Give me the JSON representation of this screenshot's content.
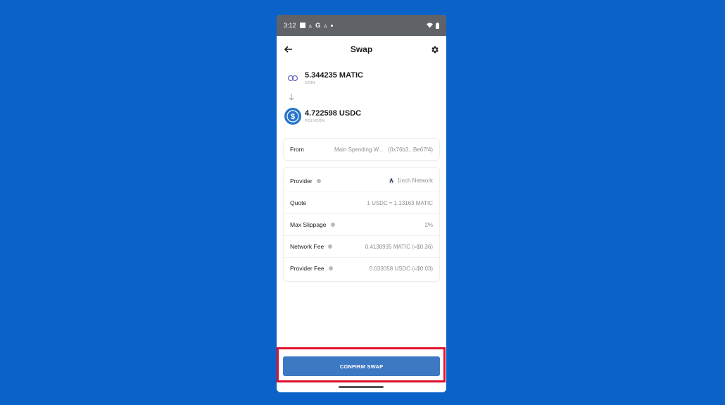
{
  "status_bar": {
    "time": "3:12"
  },
  "header": {
    "title": "Swap"
  },
  "from_asset": {
    "amount": "5.344235 MATIC",
    "network": "COIN"
  },
  "to_asset": {
    "amount": "4.722598 USDC",
    "network": "POLYGON"
  },
  "from_row": {
    "label": "From",
    "wallet": "Main Spending W...",
    "address": "(0x76b3...Be67f4)"
  },
  "details": {
    "provider": {
      "label": "Provider",
      "value": "1inch Network"
    },
    "quote": {
      "label": "Quote",
      "value": "1 USDC ≈ 1.13163 MATIC"
    },
    "slippage": {
      "label": "Max Slippage",
      "value": "2%"
    },
    "network_fee": {
      "label": "Network Fee",
      "value": "0.4130935 MATIC (≈$0.36)"
    },
    "provider_fee": {
      "label": "Provider Fee",
      "value": "0.033058 USDC (≈$0.03)"
    }
  },
  "confirm_button": {
    "label": "CONFIRM SWAP"
  },
  "colors": {
    "background": "#0b63c9",
    "button": "#3d79c3",
    "highlight": "#e0112b",
    "usdc": "#2775ca"
  }
}
